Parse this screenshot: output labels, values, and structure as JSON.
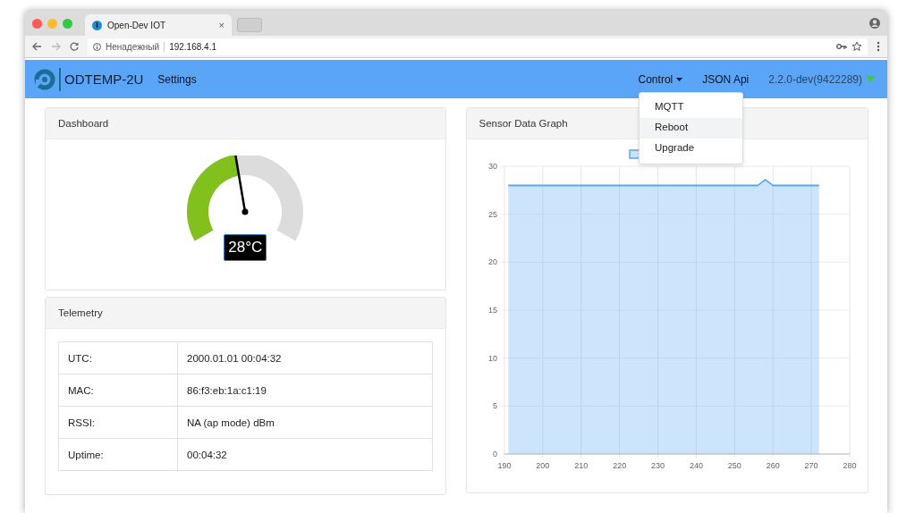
{
  "browser": {
    "tab": {
      "title": "Open-Dev IOT",
      "close": "×"
    },
    "address": {
      "security": "Ненадежный",
      "url": "192.168.4.1"
    }
  },
  "navbar": {
    "brand": "ODTEMP-2U",
    "links": [
      "Settings"
    ],
    "control": {
      "label": "Control",
      "expanded": true,
      "items": [
        {
          "label": "MQTT",
          "selected": false
        },
        {
          "label": "Reboot",
          "selected": true
        },
        {
          "label": "Upgrade",
          "selected": false
        }
      ]
    },
    "api": "JSON Api",
    "version": "2.2.0-dev(9422289)"
  },
  "dashboard": {
    "title": "Dashboard",
    "gauge": {
      "reading": "28°C"
    }
  },
  "telemetry": {
    "title": "Telemetry",
    "rows": [
      {
        "label": "UTC:",
        "value": "2000.01.01 00:04:32"
      },
      {
        "label": "MAC:",
        "value": "86:f3:eb:1a:c1:19"
      },
      {
        "label": "RSSI:",
        "value": "NA (ap mode) dBm"
      },
      {
        "label": "Uptime:",
        "value": "00:04:32"
      }
    ]
  },
  "graph": {
    "title": "Sensor Data Graph",
    "chart_data": {
      "type": "area",
      "x": [
        191,
        192,
        194,
        195,
        197,
        199,
        201,
        203,
        204,
        206,
        208,
        210,
        211,
        213,
        215,
        217,
        218,
        220,
        222,
        224,
        225,
        227,
        229,
        230,
        232,
        234,
        236,
        237,
        239,
        241,
        243,
        249,
        250,
        252,
        254,
        256,
        258,
        260,
        262,
        264,
        265,
        267,
        269,
        271,
        272
      ],
      "series": [
        {
          "color": "#5aa5f8",
          "values": [
            28,
            28,
            28,
            28,
            28,
            28,
            28,
            28,
            28,
            28,
            28,
            28,
            28,
            28,
            28,
            28,
            28,
            28,
            28,
            28,
            28,
            28,
            28,
            28,
            28,
            28,
            28,
            28,
            28,
            28,
            28,
            28,
            28,
            28,
            28,
            28,
            28.6,
            28,
            28,
            28,
            28,
            28,
            28,
            28,
            28
          ]
        }
      ],
      "xlim": [
        190,
        280
      ],
      "ylim": [
        0,
        30
      ],
      "xticks": [
        190,
        200,
        210,
        220,
        230,
        240,
        250,
        260,
        270,
        280
      ],
      "yticks": [
        0,
        5,
        10,
        15,
        20,
        25,
        30
      ],
      "grid": true
    }
  }
}
